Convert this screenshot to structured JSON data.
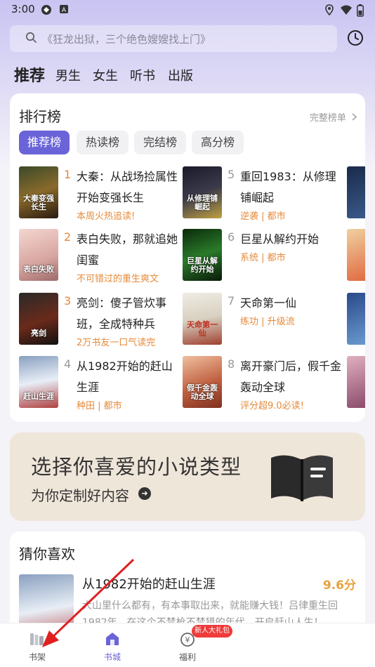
{
  "status_bar": {
    "time": "3:00"
  },
  "search": {
    "placeholder": "《狂龙出狱，三个绝色嫂嫂找上门》"
  },
  "channel_tabs": [
    {
      "label": "推荐",
      "active": true
    },
    {
      "label": "男生"
    },
    {
      "label": "女生"
    },
    {
      "label": "听书"
    },
    {
      "label": "出版"
    }
  ],
  "ranking": {
    "title": "排行榜",
    "full_link": "完整榜单",
    "subtabs": [
      {
        "label": "推荐榜",
        "active": true
      },
      {
        "label": "热读榜"
      },
      {
        "label": "完结榜"
      },
      {
        "label": "高分榜"
      }
    ],
    "items": [
      {
        "rank": "1",
        "title": "大秦：从战场捡属性开始变强长生",
        "tag": "本周火热追读!",
        "cover_text": "大秦变强长生"
      },
      {
        "rank": "2",
        "title": "表白失败，那就追她闺蜜",
        "tag": "不可错过的重生爽文",
        "cover_text": "表白失败"
      },
      {
        "rank": "3",
        "title": "亮剑：傻子管炊事班，全成特种兵",
        "tag": "2万书友一口气读完",
        "cover_text": "亮剑"
      },
      {
        "rank": "4",
        "title": "从1982开始的赶山生涯",
        "tag": "种田 | 都市",
        "cover_text": "赶山生涯"
      },
      {
        "rank": "5",
        "title": "重回1983：从修理铺崛起",
        "tag": "逆袭 | 都市",
        "cover_text": "从修理铺崛起"
      },
      {
        "rank": "6",
        "title": "巨星从解约开始",
        "tag": "系统 | 都市",
        "cover_text": "巨星从解约开始"
      },
      {
        "rank": "7",
        "title": "天命第一仙",
        "tag": "练功 | 升级流",
        "cover_text": "天命第一仙"
      },
      {
        "rank": "8",
        "title": "离开豪门后，假千金轰动全球",
        "tag": "评分超9.0必读!",
        "cover_text": "假千金轰动全球"
      }
    ]
  },
  "banner": {
    "title": "选择你喜爱的小说类型",
    "subtitle": "为你定制好内容"
  },
  "guess": {
    "title": "猜你喜欢",
    "book": {
      "title": "从1982开始的赶山生涯",
      "score": "9.6分",
      "desc": "大山里什么都有，有本事取出来，就能赚大钱！吕律重生回1982年，在这个不禁枪不禁猎的年代，开启赶山人生！"
    }
  },
  "bottom_nav": [
    {
      "label": "书架",
      "icon": "bookshelf-icon"
    },
    {
      "label": "书城",
      "icon": "bookstore-icon",
      "active": true
    },
    {
      "label": "福利",
      "icon": "welfare-icon",
      "badge": "新人大礼包"
    }
  ],
  "colors": {
    "accent": "#6a64d8",
    "tag": "#e58a3a",
    "score": "#e8a23a",
    "annotation": "#e02020"
  }
}
